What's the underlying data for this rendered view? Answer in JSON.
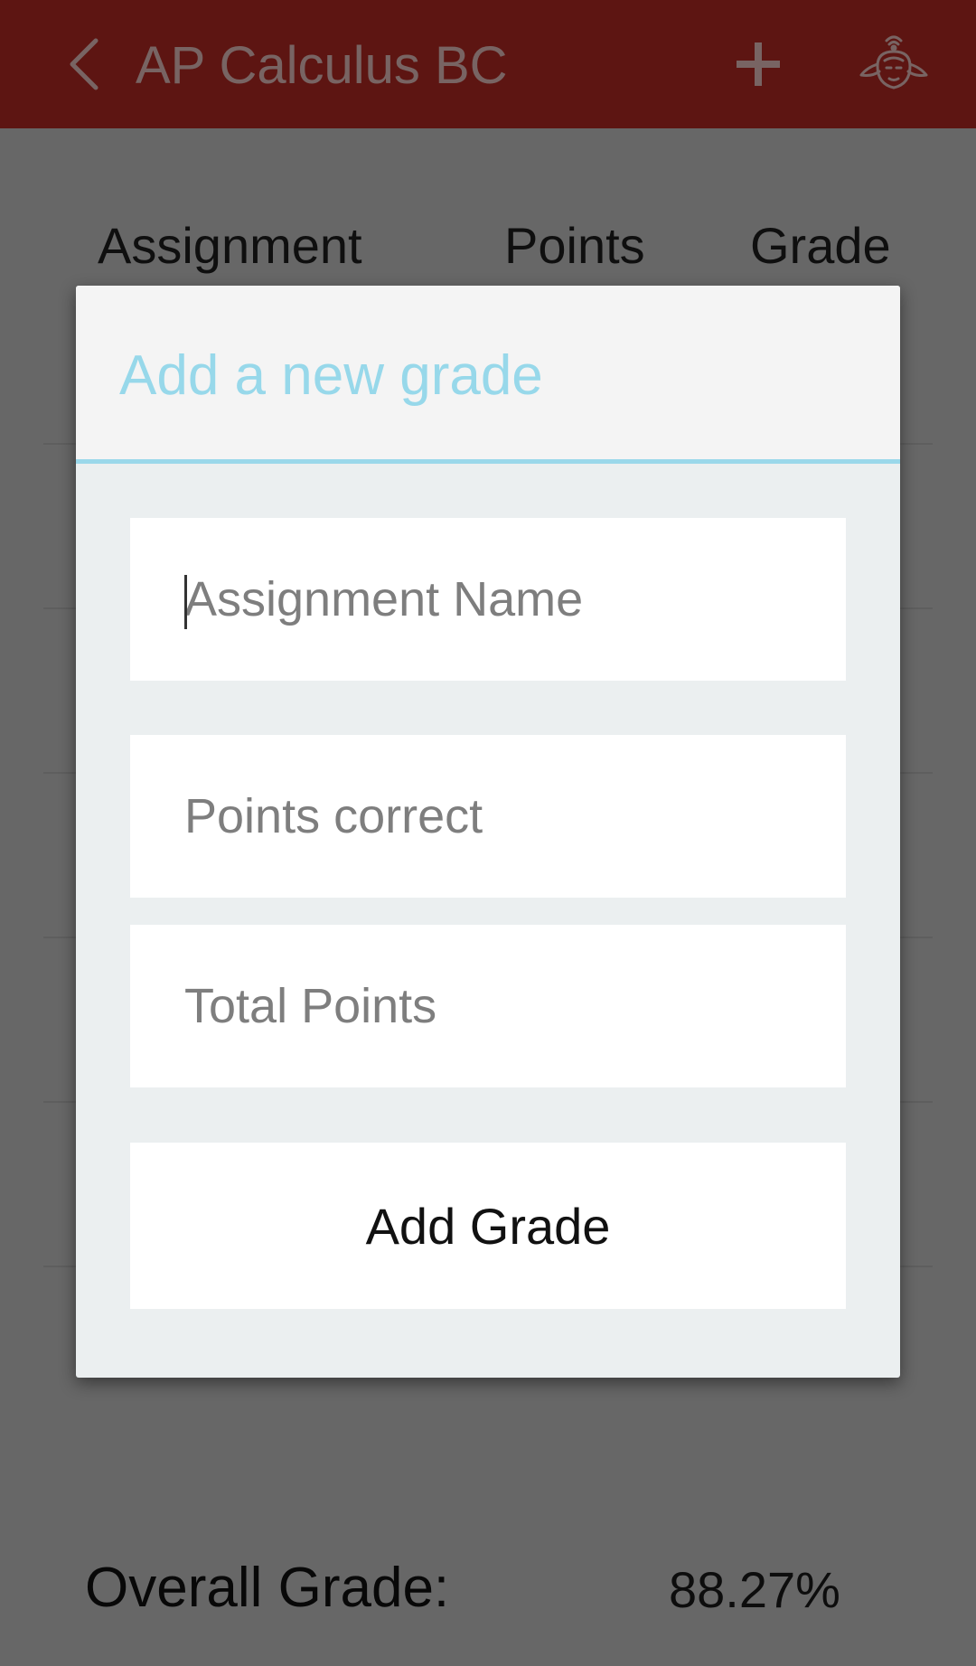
{
  "appbar": {
    "title": "AP Calculus BC",
    "back_icon": "chevron-left-icon",
    "add_icon": "plus-icon",
    "profile_icon": "avatar-icon",
    "background_color": "#bb2a24"
  },
  "table": {
    "headers": {
      "assignment": "Assignment",
      "points": "Points",
      "grade": "Grade"
    }
  },
  "summary": {
    "overall_label": "Overall Grade:",
    "overall_value": "88.27%"
  },
  "dialog": {
    "title": "Add a new grade",
    "accent_color": "#97d8ea",
    "fields": {
      "assignment_name": {
        "value": "",
        "placeholder": "Assignment Name"
      },
      "points_correct": {
        "value": "",
        "placeholder": "Points correct"
      },
      "total_points": {
        "value": "",
        "placeholder": "Total Points"
      }
    },
    "submit_label": "Add Grade"
  }
}
